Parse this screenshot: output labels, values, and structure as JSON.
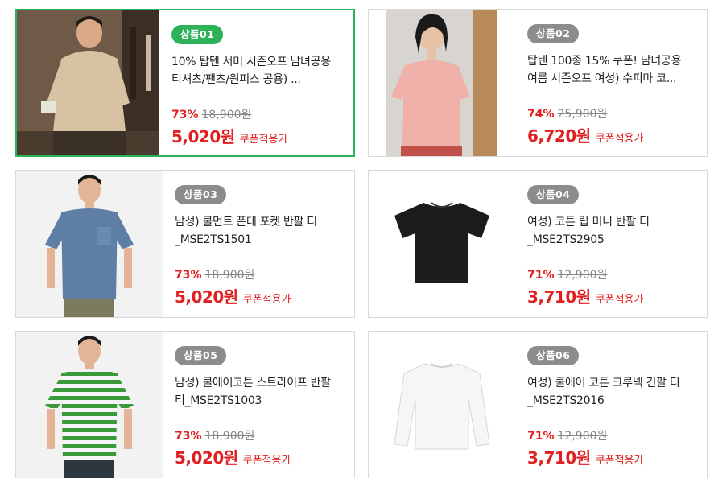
{
  "products": [
    {
      "badge": "상품01",
      "title": "10% 탑텐 서머 시즌오프 남녀공용 티셔츠/팬츠/원피스 공용) ...",
      "discount": "73%",
      "original_price": "18,900원",
      "sale_price": "5,020원",
      "coupon_label": "쿠폰적용가",
      "image": "man-beige-polo-photo"
    },
    {
      "badge": "상품02",
      "title": "탑텐 100종 15% 쿠폰! 남녀공용 여름 시즌오프 여성) 수피마 코...",
      "discount": "74%",
      "original_price": "25,900원",
      "sale_price": "6,720원",
      "coupon_label": "쿠폰적용가",
      "image": "woman-pink-knit-photo"
    },
    {
      "badge": "상품03",
      "title": "남성) 쿨먼트 폰테 포켓 반팔 티_MSE2TS1501",
      "discount": "73%",
      "original_price": "18,900원",
      "sale_price": "5,020원",
      "coupon_label": "쿠폰적용가",
      "image": "man-blue-tshirt-photo"
    },
    {
      "badge": "상품04",
      "title": "여성) 코튼 립 미니 반팔 티_MSE2TS2905",
      "discount": "71%",
      "original_price": "12,900원",
      "sale_price": "3,710원",
      "coupon_label": "쿠폰적용가",
      "image": "black-crop-tee-photo"
    },
    {
      "badge": "상품05",
      "title": "남성) 쿨에어코튼 스트라이프 반팔 티_MSE2TS1003",
      "discount": "73%",
      "original_price": "18,900원",
      "sale_price": "5,020원",
      "coupon_label": "쿠폰적용가",
      "image": "man-green-stripe-tee-photo"
    },
    {
      "badge": "상품06",
      "title": "여성) 쿨에어 코튼 크루넥 긴팔 티_MSE2TS2016",
      "discount": "71%",
      "original_price": "12,900원",
      "sale_price": "3,710원",
      "coupon_label": "쿠폰적용가",
      "image": "white-longsleeve-tee-photo"
    }
  ],
  "colors": {
    "accent_green": "#2cb35a",
    "badge_gray": "#8c8c8c",
    "price_red": "#e02020"
  }
}
